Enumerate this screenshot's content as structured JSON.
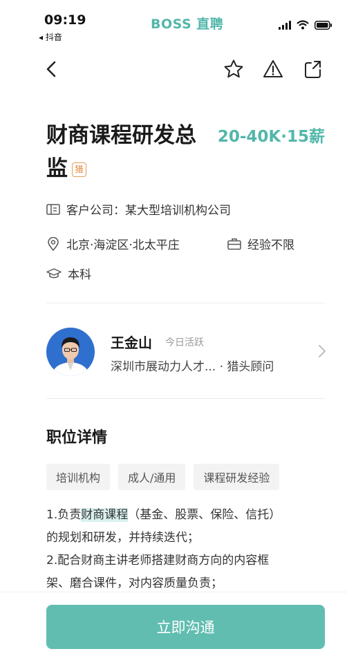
{
  "status_bar": {
    "time": "09:19",
    "back_app": "◂ 抖音",
    "brand": "BOSS 直聘"
  },
  "job": {
    "title": "财商课程研发总监",
    "hunter_badge": "猎",
    "salary": "20-40K·15薪",
    "client_company": "客户公司：某大型培训机构公司",
    "location": "北京·海淀区·北太平庄",
    "experience": "经验不限",
    "education": "本科"
  },
  "recruiter": {
    "name": "王金山",
    "active": "今日活跃",
    "company_role": "深圳市展动力人才... · 猎头顾问"
  },
  "details": {
    "section_title": "职位详情",
    "tags": [
      "培训机构",
      "成人/通用",
      "课程研发经验"
    ],
    "line1_prefix": "1.负责",
    "line1_highlight": "财商课程",
    "line1_suffix": "（基金、股票、保险、信托）",
    "line2": "的规划和研发，并持续迭代；",
    "line3": "2.配合财商主讲老师搭建财商方向的内容框",
    "line4": "架、磨合课件，对内容质量负责；"
  },
  "cta": {
    "label": "立即沟通"
  },
  "colors": {
    "accent": "#52b7aa",
    "cta_bg": "#62bdb1",
    "badge": "#e07b2a"
  },
  "icons": [
    "back-arrow-icon",
    "star-icon",
    "warning-icon",
    "share-icon",
    "company-icon",
    "location-icon",
    "briefcase-icon",
    "graduation-cap-icon",
    "chevron-right-icon"
  ]
}
